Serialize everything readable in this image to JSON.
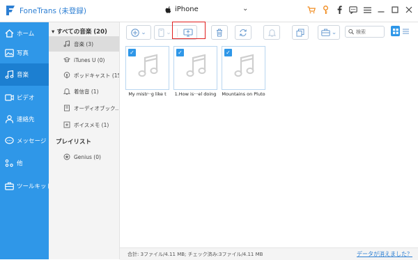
{
  "app": {
    "title": "FoneTrans (未登録)",
    "device": "iPhone"
  },
  "sidebar": {
    "items": [
      {
        "label": "ホーム",
        "icon": "home-icon"
      },
      {
        "label": "写真",
        "icon": "photo-icon"
      },
      {
        "label": "音楽",
        "icon": "music-icon",
        "active": true
      },
      {
        "label": "ビデオ",
        "icon": "video-icon"
      },
      {
        "label": "連絡先",
        "icon": "contacts-icon"
      },
      {
        "label": "メッセージ",
        "icon": "message-icon"
      },
      {
        "label": "他",
        "icon": "other-icon"
      },
      {
        "label": "ツールキット",
        "icon": "toolkit-icon"
      }
    ]
  },
  "tree": {
    "all_music": "すべての音楽 (20)",
    "items": [
      {
        "label": "音楽 (3)",
        "icon": "music-icon",
        "selected": true
      },
      {
        "label": "iTunes U (0)",
        "icon": "itunes-u-icon"
      },
      {
        "label": "ポッドキャスト (15)",
        "icon": "podcast-icon"
      },
      {
        "label": "着信音 (1)",
        "icon": "ringtone-icon"
      },
      {
        "label": "オーディオブック...",
        "icon": "audiobook-icon"
      },
      {
        "label": "ボイスメモ (1)",
        "icon": "voice-memo-icon"
      }
    ],
    "playlist_header": "プレイリスト",
    "playlists": [
      {
        "label": "Genius (0)",
        "icon": "playlist-icon"
      }
    ]
  },
  "search": {
    "placeholder": "検索"
  },
  "songs": [
    {
      "title": "My mistr··g like t"
    },
    {
      "title": "1.How is···el doing"
    },
    {
      "title": "Mountains on Pluto"
    }
  ],
  "footer": {
    "summary": "合計: 3ファイル/4.11 MB; チェック済み:3ファイル/4.11 MB",
    "link": "データが消えました？"
  },
  "colors": {
    "sidebar": "#2f97e8",
    "sidebar_active": "#1c7fd1",
    "accent": "#2d7fd3",
    "highlight": "#e01e1e"
  }
}
